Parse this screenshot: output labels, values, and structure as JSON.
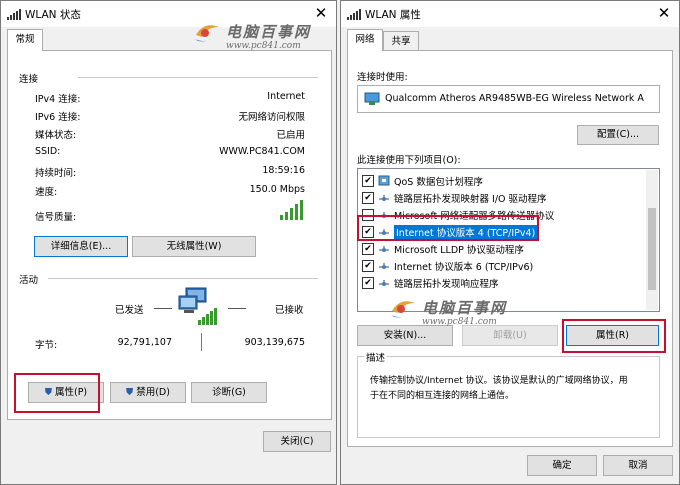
{
  "status_window": {
    "title": "WLAN 状态",
    "tabs": [
      "常规"
    ],
    "connection_header": "连接",
    "rows": [
      {
        "label": "IPv4 连接:",
        "value": "Internet"
      },
      {
        "label": "IPv6 连接:",
        "value": "无网络访问权限"
      },
      {
        "label": "媒体状态:",
        "value": "已启用"
      },
      {
        "label": "SSID:",
        "value": "WWW.PC841.COM"
      },
      {
        "label": "持续时间:",
        "value": "18:59:16"
      },
      {
        "label": "速度:",
        "value": "150.0 Mbps"
      }
    ],
    "signal_label": "信号质量:",
    "signal_bars": 5,
    "details_button": "详细信息(E)...",
    "wireless_props_button": "无线属性(W)",
    "activity_header": "活动",
    "sent_label": "已发送",
    "received_label": "已接收",
    "bytes_label": "字节:",
    "bytes_sent": "92,791,107",
    "bytes_received": "903,139,675",
    "properties_button": "属性(P)",
    "disable_button": "禁用(D)",
    "diagnose_button": "诊断(G)",
    "close_button": "关闭(C)"
  },
  "props_window": {
    "title": "WLAN 属性",
    "tabs": [
      "网络",
      "共享"
    ],
    "connect_using_label": "连接时使用:",
    "adapter_name": "Qualcomm Atheros AR9485WB-EG Wireless Network A",
    "configure_button": "配置(C)...",
    "items_label": "此连接使用下列项目(O):",
    "items": [
      {
        "text": "QoS 数据包计划程序",
        "checked": true,
        "icon": "qos-icon"
      },
      {
        "text": "链路层拓扑发现映射器 I/O 驱动程序",
        "checked": true,
        "icon": "protocol-icon"
      },
      {
        "text": "Microsoft 网络适配器多路传送器协议",
        "checked": false,
        "icon": "protocol-icon"
      },
      {
        "text": "Internet 协议版本 4 (TCP/IPv4)",
        "checked": true,
        "icon": "protocol-icon",
        "selected": true
      },
      {
        "text": "Microsoft LLDP 协议驱动程序",
        "checked": true,
        "icon": "protocol-icon"
      },
      {
        "text": "Internet 协议版本 6 (TCP/IPv6)",
        "checked": true,
        "icon": "protocol-icon"
      },
      {
        "text": "链路层拓扑发现响应程序",
        "checked": true,
        "icon": "protocol-icon"
      }
    ],
    "install_button": "安装(N)...",
    "uninstall_button": "卸载(U)",
    "properties_button": "属性(R)",
    "description_header": "描述",
    "description_text_1": "传输控制协议/Internet 协议。该协议是默认的广域网络协议，用",
    "description_text_2": "于在不同的相互连接的网络上通信。",
    "ok_button": "确定",
    "cancel_button": "取消"
  },
  "watermark": {
    "cn": "电脑百事网",
    "url": "www.pc841.com"
  },
  "colors": {
    "highlight": "#c8102e",
    "selection": "#0078d7",
    "signal": "#3a9a2f"
  }
}
